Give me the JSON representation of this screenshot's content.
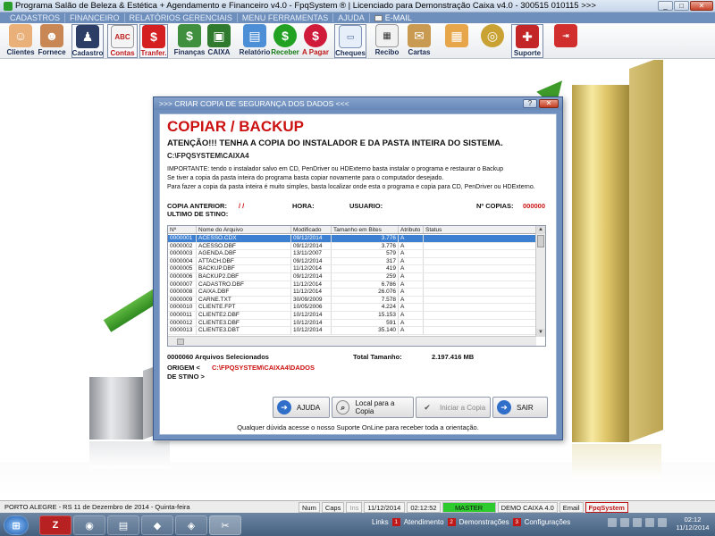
{
  "window": {
    "title": "Programa Salão de Beleza & Estética + Agendamento e Financeiro v4.0 - FpqSystem ® | Licenciado para  Demonstração Caixa v4.0 - 300515 010115 >>>"
  },
  "menu": [
    "CADASTROS",
    "FINANCEIRO",
    "RELATÓRIOS GERENCIAIS",
    "MENU FERRAMENTAS",
    "AJUDA",
    "E-MAIL"
  ],
  "toolbar": [
    {
      "label": "Clientes",
      "icon": "clients-icon"
    },
    {
      "label": "Fornece",
      "icon": "supplier-icon"
    },
    {
      "label": "Cadastro",
      "icon": "register-icon"
    },
    {
      "label": "Contas",
      "icon": "accounts-icon"
    },
    {
      "label": "Tranfer.",
      "icon": "transfer-icon"
    },
    {
      "label": "Finanças",
      "icon": "finance-icon"
    },
    {
      "label": "CAIXA",
      "icon": "cashbox-icon"
    },
    {
      "label": "Relatório",
      "icon": "report-icon"
    },
    {
      "label": "Receber",
      "icon": "receive-icon"
    },
    {
      "label": "A Pagar",
      "icon": "pay-icon"
    },
    {
      "label": "Cheques",
      "icon": "cheque-icon"
    },
    {
      "label": "Recibo",
      "icon": "receipt-icon"
    },
    {
      "label": "Cartas",
      "icon": "letters-icon"
    },
    {
      "label": "",
      "icon": "calculator-icon"
    },
    {
      "label": "",
      "icon": "coins-icon"
    },
    {
      "label": "Suporte",
      "icon": "support-icon"
    },
    {
      "label": "",
      "icon": "exit-icon"
    }
  ],
  "dialog": {
    "title": ">>> CRIAR COPIA DE SEGURANÇA DOS DADOS <<<",
    "heading": "COPIAR / BACKUP",
    "warning": "ATENÇÃO!!!  TENHA A COPIA DO  INSTALADOR  E  DA PASTA INTEIRA DO  SISTEMA.",
    "path": "C:\\FPQSYSTEM\\CAIXA4",
    "info": [
      "IMPORTANTE: tendo o instalador salvo em CD, PenDriver ou HDExterno basta instalar o programa e restaurar o Backup",
      "Se tiver a copia da pasta inteira do programa basta copiar novamente para o computador desejado.",
      "Para fazer a copia da pasta inteira é muito simples, basta localizar onde esta o programa e copia para CD, PenDriver ou HDExterno."
    ],
    "copia_anterior_label": "COPIA ANTERIOR:",
    "copia_anterior_value": "/ /",
    "hora_label": "HORA:",
    "usuario_label": "USUARIO:",
    "ncopias_label": "Nº COPIAS:",
    "ncopias_value": "000000",
    "ultimo_destino_label": "ULTIMO DE STINO:",
    "selected_label": "0000060 Arquivos Selecionados",
    "total_label": "Total Tamanho:",
    "total_value": "2.197.416 MB",
    "origem_label": "ORIGEM  <",
    "origem_value": "C:\\FPQSYSTEM\\CAIXA4\\DADOS",
    "destino_label": "DE STINO >",
    "buttons": {
      "ajuda": "AJUDA",
      "local": "Local para a Copia",
      "iniciar": "Iniciar a Copia",
      "sair": "SAIR"
    },
    "footer": "Qualquer dúvida acesse o nosso Suporte OnLine para receber toda a orientação."
  },
  "grid": {
    "columns": [
      "Nº",
      "Nome do Arquivo",
      "Modificado",
      "Tamanho em Bites",
      "Atributo",
      "Status"
    ],
    "rows": [
      [
        "0000001",
        "ACESSO.CDX",
        "09/12/2014",
        "3.776",
        "A",
        ""
      ],
      [
        "0000002",
        "ACESSO.DBF",
        "09/12/2014",
        "3.776",
        "A",
        ""
      ],
      [
        "0000003",
        "AGENDA.DBF",
        "13/11/2007",
        "579",
        "A",
        ""
      ],
      [
        "0000004",
        "ATTACH.DBF",
        "09/12/2014",
        "317",
        "A",
        ""
      ],
      [
        "0000005",
        "BACKUP.DBF",
        "11/12/2014",
        "419",
        "A",
        ""
      ],
      [
        "0000006",
        "BACKUP2.DBF",
        "09/12/2014",
        "259",
        "A",
        ""
      ],
      [
        "0000007",
        "CADASTRO.DBF",
        "11/12/2014",
        "6.786",
        "A",
        ""
      ],
      [
        "0000008",
        "CAIXA.DBF",
        "11/12/2014",
        "26.076",
        "A",
        ""
      ],
      [
        "0000009",
        "CARNE.TXT",
        "30/09/2009",
        "7.578",
        "A",
        ""
      ],
      [
        "0000010",
        "CLIENTE.FPT",
        "10/05/2006",
        "4.224",
        "A",
        ""
      ],
      [
        "0000011",
        "CLIENTE2.DBF",
        "10/12/2014",
        "15.153",
        "A",
        ""
      ],
      [
        "0000012",
        "CLIENTE3.DBF",
        "10/12/2014",
        "591",
        "A",
        ""
      ],
      [
        "0000013",
        "CLIENTE3.DBT",
        "10/12/2014",
        "35.140",
        "A",
        ""
      ]
    ]
  },
  "statusbar": {
    "location": "PORTO ALEGRE - RS 11 de Dezembro de 2014 - Quinta-feira",
    "num": "Num",
    "caps": "Caps",
    "ins": "Ins",
    "date": "11/12/2014",
    "time": "02:12:52",
    "master": "MASTER",
    "demo": "DEMO CAIXA 4.0",
    "email": "Email",
    "brand": "FpqSystem"
  },
  "taskbar": {
    "links_label": "Links",
    "links": [
      {
        "num": "1",
        "label": "Atendimento"
      },
      {
        "num": "2",
        "label": "Demonstrações"
      },
      {
        "num": "3",
        "label": "Configurações"
      }
    ],
    "clock_time": "02:12",
    "clock_date": "11/12/2014"
  }
}
